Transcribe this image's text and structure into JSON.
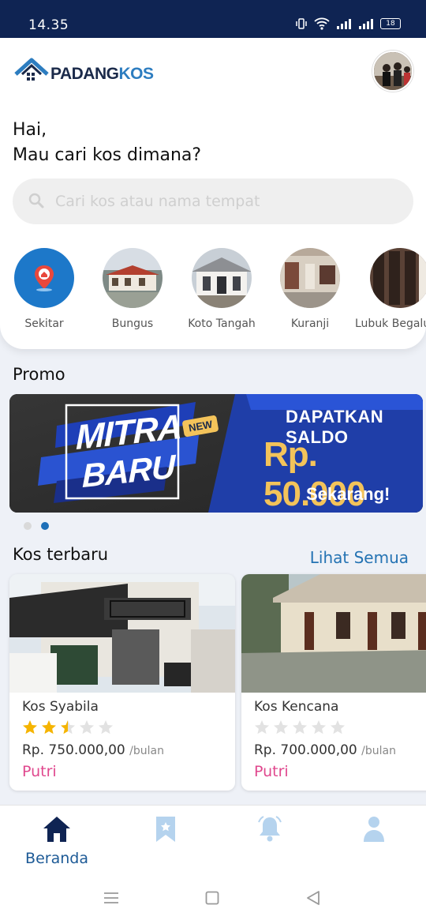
{
  "status_bar": {
    "time": "14.35",
    "battery": "18"
  },
  "header": {
    "logo_part1": "PADANG",
    "logo_part2": "KOS"
  },
  "greeting": {
    "line1": "Hai,",
    "line2": "Mau cari kos dimana?"
  },
  "search": {
    "placeholder": "Cari kos atau nama tempat"
  },
  "areas": [
    {
      "label": "Sekitar"
    },
    {
      "label": "Bungus"
    },
    {
      "label": "Koto Tangah"
    },
    {
      "label": "Kuranji"
    },
    {
      "label": "Lubuk Begalung"
    }
  ],
  "promo": {
    "title": "Promo",
    "banner": {
      "headline1": "MITRA",
      "headline2": "BARU",
      "badge": "NEW",
      "line1": "DAPATKAN SALDO",
      "amount": "Rp. 50.000",
      "line2": "Sekarang!"
    }
  },
  "latest": {
    "title": "Kos terbaru",
    "see_all": "Lihat Semua",
    "cards": [
      {
        "name": "Kos Syabila",
        "rating": 2.5,
        "price": "Rp. 750.000,00",
        "period": "/bulan",
        "type": "Putri"
      },
      {
        "name": "Kos Kencana",
        "rating": 0,
        "price": "Rp. 700.000,00",
        "period": "/bulan",
        "type": "Putri"
      }
    ]
  },
  "bottom_nav": {
    "home_label": "Beranda"
  },
  "colors": {
    "primary": "#0f2453",
    "accent": "#2473b3",
    "pink": "#e0488e",
    "star": "#f5b400"
  }
}
